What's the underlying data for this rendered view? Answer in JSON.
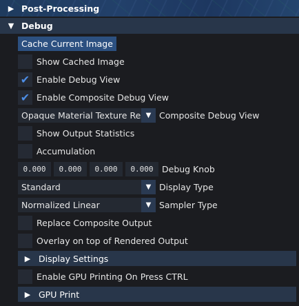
{
  "post_processing": {
    "label": "Post-Processing"
  },
  "debug": {
    "label": "Debug",
    "cache_button": "Cache Current Image",
    "show_cached_image": {
      "label": "Show Cached Image",
      "checked": false
    },
    "enable_debug_view": {
      "label": "Enable Debug View",
      "checked": true
    },
    "enable_composite_debug_view": {
      "label": "Enable Composite Debug View",
      "checked": true
    },
    "composite_debug_view": {
      "value": "Opaque Material Texture Res",
      "label": "Composite Debug View"
    },
    "show_output_statistics": {
      "label": "Show Output Statistics",
      "checked": false
    },
    "accumulation": {
      "label": "Accumulation",
      "checked": false
    },
    "debug_knob": {
      "values": [
        "0.000",
        "0.000",
        "0.000",
        "0.000"
      ],
      "label": "Debug Knob"
    },
    "display_type": {
      "value": "Standard",
      "label": "Display Type"
    },
    "sampler_type": {
      "value": "Normalized Linear",
      "label": "Sampler Type"
    },
    "replace_composite_output": {
      "label": "Replace Composite Output",
      "checked": false
    },
    "overlay_on_top": {
      "label": "Overlay on top of Rendered Output",
      "checked": false
    },
    "display_settings": {
      "label": "Display Settings"
    },
    "enable_gpu_printing": {
      "label": "Enable GPU Printing On Press CTRL",
      "checked": false
    },
    "gpu_print": {
      "label": "GPU Print"
    }
  },
  "icons": {
    "collapsed": "triangle-right-icon",
    "expanded": "triangle-down-icon",
    "check": "checkmark-icon",
    "dropdown": "triangle-down-icon"
  },
  "colors": {
    "accent": "#4d8ee6",
    "button": "#2c5080",
    "header": "#28364a",
    "background": "#1b1c20"
  }
}
